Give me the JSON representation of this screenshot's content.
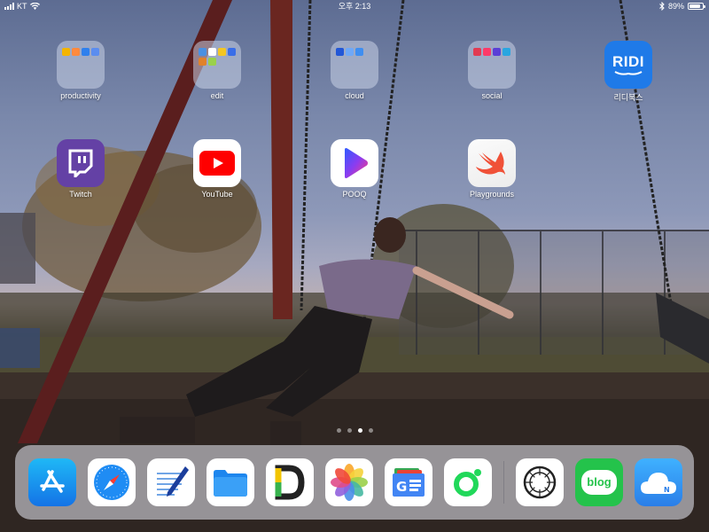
{
  "status_bar": {
    "carrier": "KT",
    "time": "오후 2:13",
    "battery": "89%",
    "battery_level": 0.89,
    "icons": [
      "signal-icon",
      "wifi-icon",
      "bluetooth-icon",
      "battery-icon"
    ]
  },
  "home_icons": [
    {
      "label": "productivity",
      "kind": "folder",
      "mini_colors": [
        "#f4b400",
        "#ff8a3d",
        "#2f80ed",
        "#5b8def"
      ]
    },
    {
      "label": "edit",
      "kind": "folder",
      "mini_colors": [
        "#4a90e2",
        "#ffffff",
        "#f3c623",
        "#3a6ee8",
        "#e0822b",
        "#9ad14b"
      ]
    },
    {
      "label": "cloud",
      "kind": "folder",
      "mini_colors": [
        "#2257d6",
        "#6fa8f7",
        "#3f8ef0"
      ]
    },
    {
      "label": "social",
      "kind": "folder",
      "mini_colors": [
        "#e23b52",
        "#fd3a69",
        "#5a3fd6",
        "#2aa6e0"
      ]
    },
    {
      "label": "리디북스",
      "kind": "app",
      "icon": "ridi-icon",
      "icon_text": "RIDI",
      "color": "#1f7ae8"
    },
    {
      "label": "Twitch",
      "kind": "app",
      "icon": "twitch-icon",
      "color": "#6441a5"
    },
    {
      "label": "YouTube",
      "kind": "app",
      "icon": "youtube-icon",
      "color": "#ff0000"
    },
    {
      "label": "POOQ",
      "kind": "app",
      "icon": "pooq-icon",
      "color": "#5b3be8"
    },
    {
      "label": "Playgrounds",
      "kind": "app",
      "icon": "swift-icon",
      "color": "#f05138"
    }
  ],
  "page_dots": {
    "count": 4,
    "active_index": 2
  },
  "dock": {
    "apps": [
      {
        "name": "App Store",
        "icon": "app-store-icon",
        "color": "#1e9cf0"
      },
      {
        "name": "Safari",
        "icon": "safari-icon",
        "color": "#1a7ef0"
      },
      {
        "name": "Notes",
        "icon": "notes-pen-icon",
        "color": "#1b6fd6"
      },
      {
        "name": "Files",
        "icon": "files-folder-icon",
        "color": "#1f8ef1"
      },
      {
        "name": "Dictionary",
        "icon": "dictionary-d-icon",
        "color": "#2a2a2a"
      },
      {
        "name": "Photos",
        "icon": "photos-icon",
        "color": "#f2b83c"
      },
      {
        "name": "Google News",
        "icon": "google-news-icon",
        "color": "#4285f4"
      },
      {
        "name": "Naver Line Dot",
        "icon": "green-ring-icon",
        "color": "#21d85a"
      },
      {
        "name": "VSCO",
        "icon": "vsco-icon",
        "color": "#222222"
      },
      {
        "name": "blog",
        "icon": "blog-icon",
        "icon_text": "blog",
        "color": "#24c34b"
      },
      {
        "name": "N Cloud",
        "icon": "ncloud-icon",
        "icon_text": "N",
        "color": "#3aa0f4"
      }
    ]
  },
  "wallpaper": {
    "description_icon": "swing-wallpaper"
  }
}
